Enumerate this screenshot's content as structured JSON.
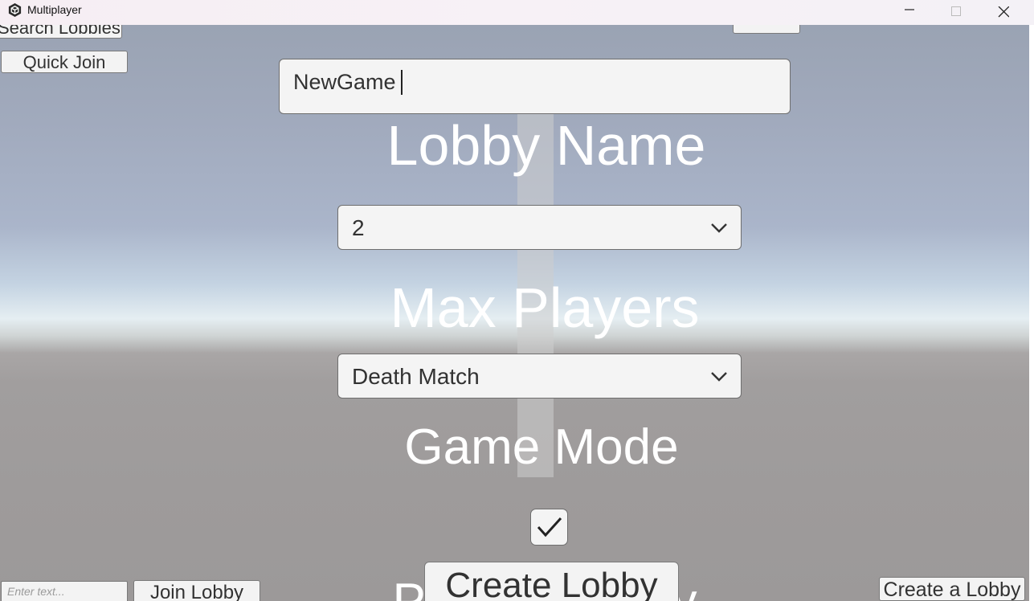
{
  "window": {
    "title": "Multiplayer",
    "icons": {
      "app": "unity-cube-icon",
      "minimize": "minimize-icon",
      "maximize": "maximize-icon",
      "close": "close-icon"
    }
  },
  "top_left": {
    "search_lobbies_label": "Search Lobbies",
    "quick_join_label": "Quick Join"
  },
  "form": {
    "lobby_name_value": "NewGame",
    "lobby_name_label": "Lobby Name",
    "max_players_value": "2",
    "max_players_label": "Max Players",
    "game_mode_value": "Death Match",
    "game_mode_label": "Game Mode",
    "private_checked": true,
    "private_label_partial": "Private Lobby",
    "create_lobby_label": "Create Lobby",
    "dropdown_icon": "chevron-down-icon",
    "checkbox_icon": "checkmark-icon"
  },
  "bottom": {
    "join_code_placeholder": "Enter text...",
    "join_lobby_label": "Join Lobby",
    "create_a_lobby_label": "Create a Lobby"
  }
}
